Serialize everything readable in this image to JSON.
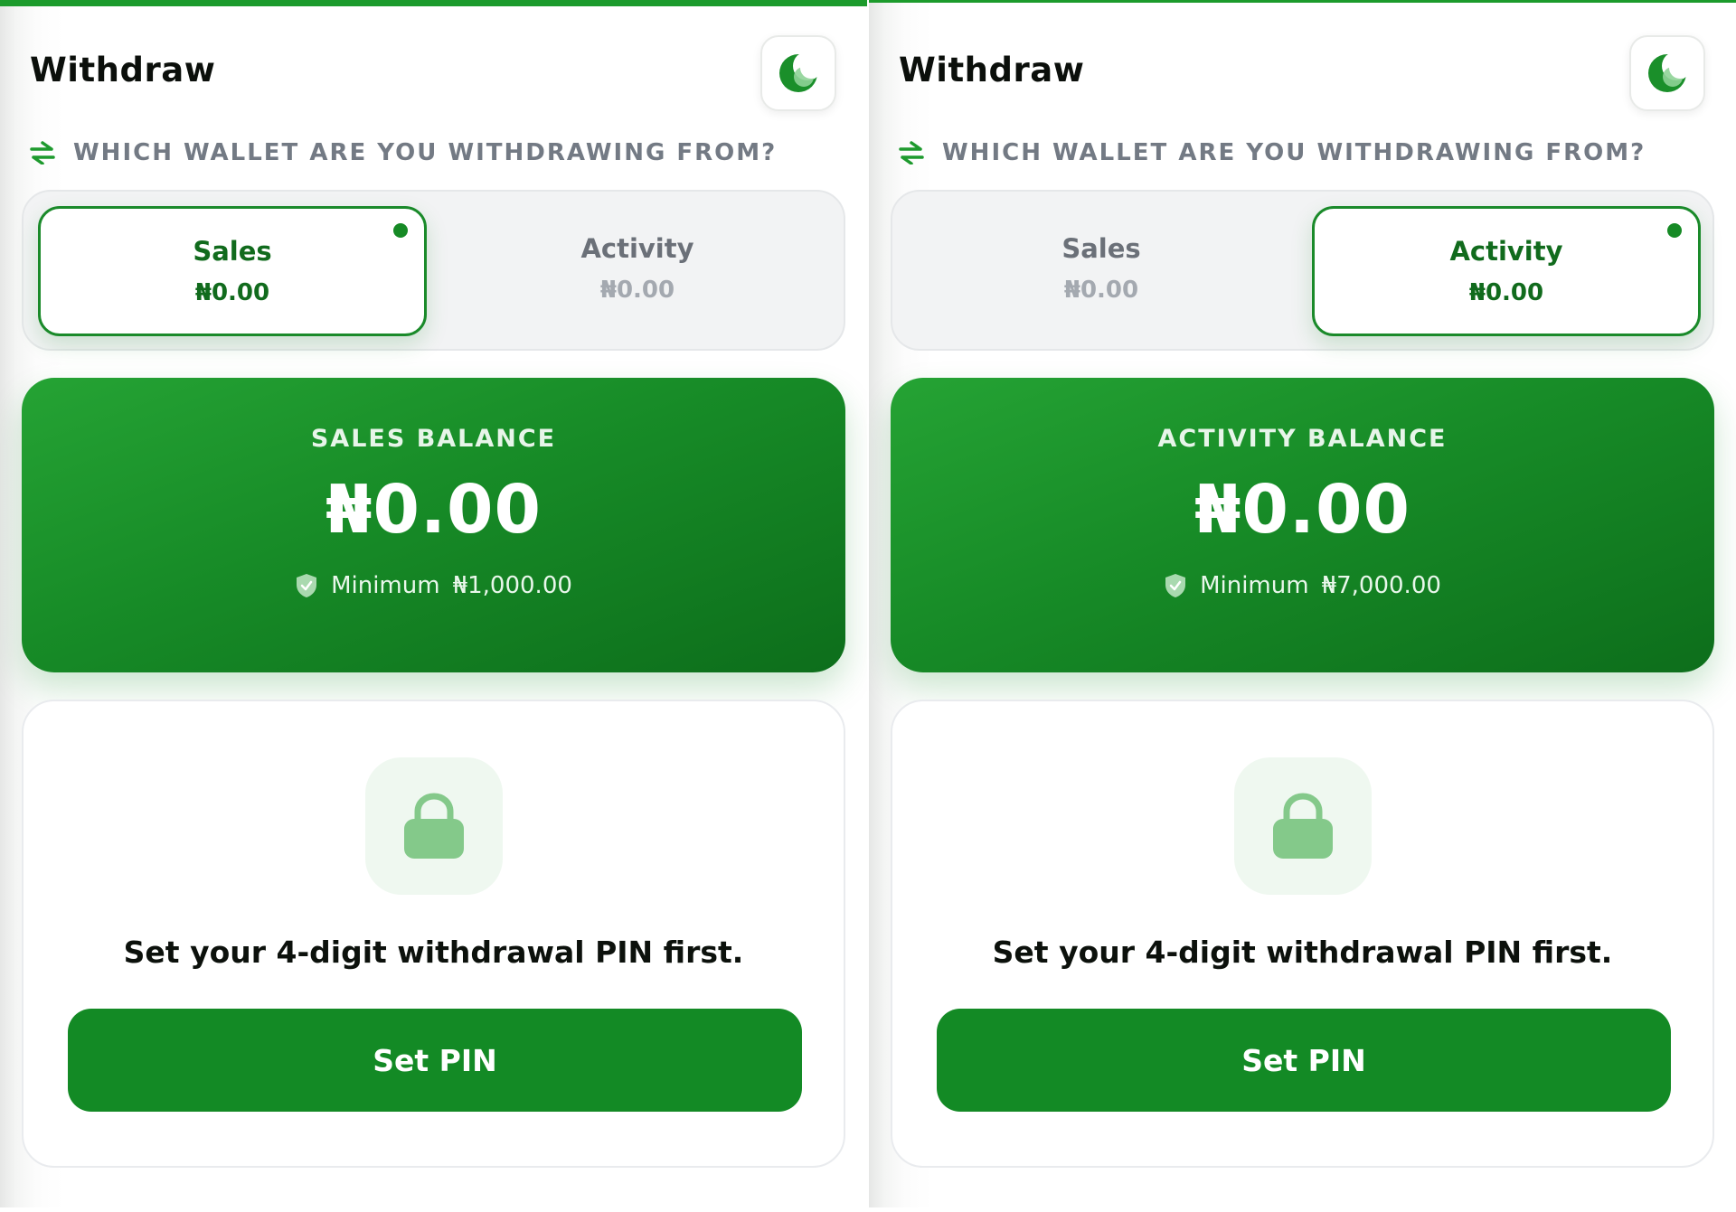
{
  "panels": [
    {
      "id": "sales-view",
      "header": {
        "title": "Withdraw",
        "theme_icon": "moon-icon"
      },
      "wallet_question": "WHICH WALLET ARE YOU WITHDRAWING FROM?",
      "wallets": [
        {
          "name": "Sales",
          "amount": "₦0.00",
          "selected": true
        },
        {
          "name": "Activity",
          "amount": "₦0.00",
          "selected": false
        }
      ],
      "balance": {
        "label": "SALES BALANCE",
        "amount": "₦0.00",
        "minimum_label": "Minimum",
        "minimum_value": "₦1,000.00"
      },
      "pin": {
        "message": "Set your 4-digit withdrawal PIN first.",
        "button_label": "Set PIN"
      }
    },
    {
      "id": "activity-view",
      "header": {
        "title": "Withdraw",
        "theme_icon": "moon-icon"
      },
      "wallet_question": "WHICH WALLET ARE YOU WITHDRAWING FROM?",
      "wallets": [
        {
          "name": "Sales",
          "amount": "₦0.00",
          "selected": false
        },
        {
          "name": "Activity",
          "amount": "₦0.00",
          "selected": true
        }
      ],
      "balance": {
        "label": "ACTIVITY BALANCE",
        "amount": "₦0.00",
        "minimum_label": "Minimum",
        "minimum_value": "₦7,000.00"
      },
      "pin": {
        "message": "Set your 4-digit withdrawal PIN first.",
        "button_label": "Set PIN"
      }
    }
  ],
  "colors": {
    "primary_green": "#138a25",
    "card_gradient_start": "#25a334",
    "card_gradient_end": "#0d6e1b",
    "selected_text": "#116b1d",
    "muted_text": "#737a84",
    "lock_tint": "#84c98a"
  }
}
